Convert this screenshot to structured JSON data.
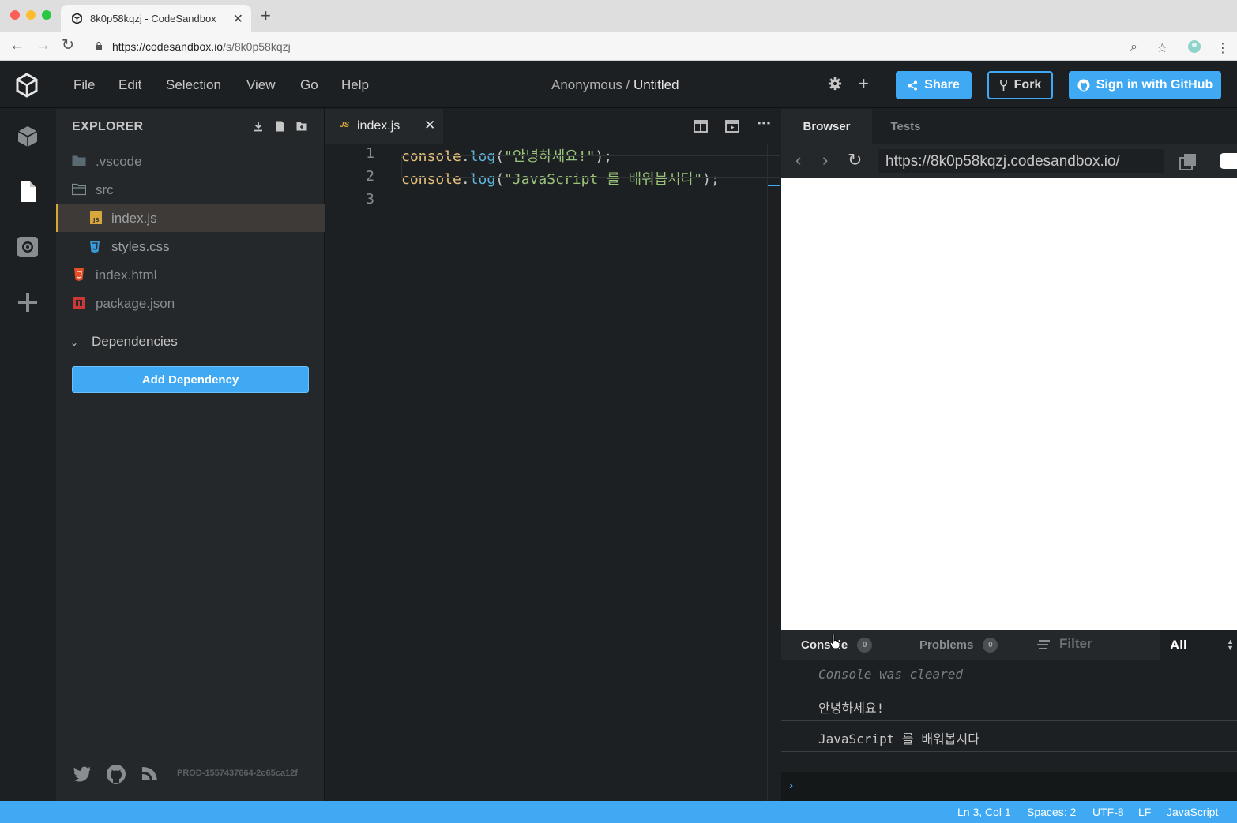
{
  "browser": {
    "tab_title": "8k0p58kqzj - CodeSandbox",
    "url_host": "https://codesandbox.io",
    "url_path": "/s/8k0p58kqzj"
  },
  "header": {
    "menu": [
      "File",
      "Edit",
      "Selection",
      "View",
      "Go",
      "Help"
    ],
    "owner": "Anonymous",
    "separator": " / ",
    "sandbox_name": "Untitled",
    "share_label": "Share",
    "fork_label": "Fork",
    "github_label": "Sign in with GitHub"
  },
  "sidebar": {
    "title": "EXPLORER",
    "tree": [
      {
        "name": ".vscode",
        "type": "folder"
      },
      {
        "name": "src",
        "type": "folder-open"
      },
      {
        "name": "index.js",
        "type": "js",
        "active": true
      },
      {
        "name": "styles.css",
        "type": "css"
      },
      {
        "name": "index.html",
        "type": "html"
      },
      {
        "name": "package.json",
        "type": "npm"
      }
    ],
    "dependencies_label": "Dependencies",
    "add_dependency_label": "Add Dependency",
    "build_version": "PROD-1557437664-2c65ca12f"
  },
  "editor": {
    "tab_badge": "JS",
    "tab_file": "index.js",
    "lines": [
      {
        "number": "1",
        "obj": "console",
        "dot": ".",
        "fn": "log",
        "open": "(",
        "str": "\"안녕하세요!\"",
        "close": ");"
      },
      {
        "number": "2",
        "obj": "console",
        "dot": ".",
        "fn": "log",
        "open": "(",
        "str": "\"JavaScript 를 배워봅시다\"",
        "close": ");"
      },
      {
        "number": "3",
        "obj": "",
        "dot": "",
        "fn": "",
        "open": "",
        "str": "",
        "close": ""
      }
    ]
  },
  "preview": {
    "tabs": [
      "Browser",
      "Tests"
    ],
    "url": "https://8k0p58kqzj.codesandbox.io/"
  },
  "console": {
    "tab_console": "Console",
    "console_count": "0",
    "tab_problems": "Problems",
    "problems_count": "0",
    "filter_placeholder": "Filter",
    "level": "All",
    "messages": [
      "Console was cleared",
      "안녕하세요!",
      "JavaScript 를 배워봅시다"
    ],
    "prompt": "›"
  },
  "status_bar": {
    "position": "Ln 3, Col 1",
    "spaces": "Spaces: 2",
    "encoding": "UTF-8",
    "eol": "LF",
    "language": "JavaScript"
  },
  "colors": {
    "accent": "#40a9f3",
    "background": "#1c2022",
    "sidebar": "#24282a",
    "active_file_border": "#d8a63b"
  }
}
